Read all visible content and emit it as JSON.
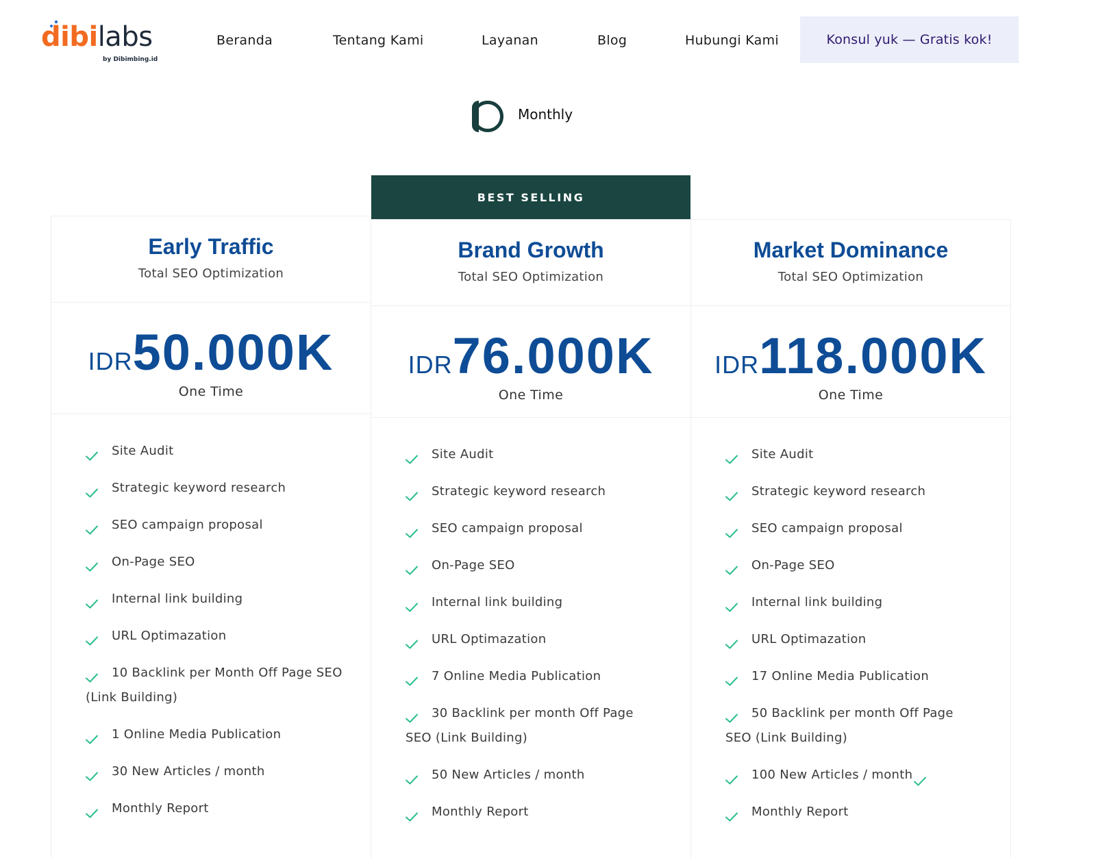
{
  "brand": {
    "logo_main_orange": "dibi",
    "logo_main_dark": "labs",
    "logo_sub": "by Dibimbing.id"
  },
  "nav": {
    "items": [
      "Beranda",
      "Tentang Kami",
      "Layanan",
      "Blog",
      "Hubungi Kami"
    ],
    "cta": "Konsul yuk — Gratis kok!"
  },
  "billing": {
    "label": "Monthly"
  },
  "badge": "BEST SELLING",
  "colors": {
    "accent_blue": "#0e4c96",
    "dark_green": "#1a4541",
    "check_green": "#2bbf8a",
    "brand_orange": "#f26b21"
  },
  "plans": [
    {
      "title": "Early Traffic",
      "subtitle": "Total SEO Optimization",
      "currency": "IDR",
      "price": "50.000K",
      "term": "One Time",
      "features": [
        "Site Audit",
        "Strategic keyword research",
        "SEO campaign proposal",
        "On-Page SEO",
        "Internal link building",
        "URL Optimazation",
        "10 Backlink per Month Off Page SEO (Link Building)",
        "1 Online Media Publication",
        "30 New Articles / month",
        "Monthly Report"
      ]
    },
    {
      "title": "Brand Growth",
      "subtitle": "Total SEO Optimization",
      "currency": "IDR",
      "price": "76.000K",
      "term": "One Time",
      "features": [
        "Site Audit",
        "Strategic keyword research",
        "SEO campaign proposal",
        "On-Page SEO",
        "Internal link building",
        "URL Optimazation",
        "7 Online Media Publication",
        "30 Backlink per month Off Page SEO (Link Building)",
        "50 New Articles / month",
        "Monthly Report"
      ]
    },
    {
      "title": "Market Dominance",
      "subtitle": "Total SEO Optimization",
      "currency": "IDR",
      "price": "118.000K",
      "term": "One Time",
      "features": [
        "Site Audit",
        "Strategic keyword research",
        "SEO campaign proposal",
        "On-Page SEO",
        "Internal link building",
        "URL Optimazation",
        "17 Online Media Publication",
        "50 Backlink per month Off Page SEO (Link Building)",
        "100 New Articles / month",
        "Monthly Report"
      ]
    }
  ]
}
